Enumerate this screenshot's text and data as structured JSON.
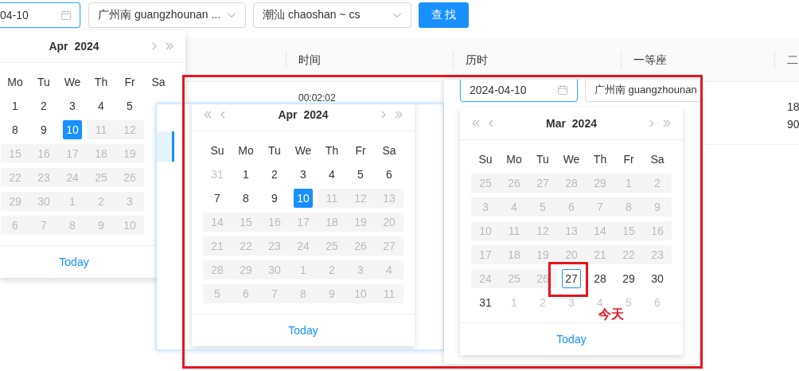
{
  "toolbar": {
    "date_field": {
      "value": "04-10"
    },
    "from_station": {
      "value": "广州南 guangzhounan ..."
    },
    "to_station": {
      "value": "潮汕 chaoshan ~ cs"
    },
    "search_button": {
      "label": "查 找"
    }
  },
  "table": {
    "columns": [
      {
        "label": "时间"
      },
      {
        "label": "历时"
      },
      {
        "label": "一等座"
      },
      {
        "label": "二"
      }
    ],
    "row": {
      "time": "00:02:02",
      "column_4": [
        "18",
        "90"
      ]
    }
  },
  "dropdown_calendar": {
    "title": "Apr 2024",
    "nav_buttons": [
      {
        "kind": "next-month"
      },
      {
        "kind": "next-year"
      }
    ],
    "weekdays": [
      "Mo",
      "Tu",
      "We",
      "Th",
      "Fr",
      "Sa"
    ],
    "weeks": [
      [
        {
          "day": "1",
          "kind": "current",
          "selected": false
        },
        {
          "day": "2",
          "kind": "current",
          "selected": false
        },
        {
          "day": "3",
          "kind": "current",
          "selected": false
        },
        {
          "day": "4",
          "kind": "current",
          "selected": false
        },
        {
          "day": "5",
          "kind": "current",
          "selected": false
        }
      ],
      [
        {
          "day": "8",
          "kind": "current",
          "selected": false
        },
        {
          "day": "9",
          "kind": "current",
          "selected": false
        },
        {
          "day": "10",
          "kind": "current",
          "selected": true
        },
        {
          "day": "11",
          "kind": "disabled",
          "selected": false
        },
        {
          "day": "12",
          "kind": "disabled",
          "selected": false
        }
      ],
      [
        {
          "day": "15",
          "kind": "disabled",
          "selected": false
        },
        {
          "day": "16",
          "kind": "disabled",
          "selected": false
        },
        {
          "day": "17",
          "kind": "disabled",
          "selected": false
        },
        {
          "day": "18",
          "kind": "disabled",
          "selected": false
        },
        {
          "day": "19",
          "kind": "disabled",
          "selected": false
        }
      ],
      [
        {
          "day": "22",
          "kind": "disabled",
          "selected": false
        },
        {
          "day": "23",
          "kind": "disabled",
          "selected": false
        },
        {
          "day": "24",
          "kind": "disabled",
          "selected": false
        },
        {
          "day": "25",
          "kind": "disabled",
          "selected": false
        },
        {
          "day": "26",
          "kind": "disabled",
          "selected": false
        }
      ],
      [
        {
          "day": "29",
          "kind": "disabled",
          "selected": false
        },
        {
          "day": "30",
          "kind": "disabled",
          "selected": false
        },
        {
          "day": "1",
          "kind": "disabled",
          "selected": false
        },
        {
          "day": "2",
          "kind": "disabled",
          "selected": false
        },
        {
          "day": "3",
          "kind": "disabled",
          "selected": false
        }
      ],
      [
        {
          "day": "6",
          "kind": "disabled",
          "selected": false
        },
        {
          "day": "7",
          "kind": "disabled",
          "selected": false
        },
        {
          "day": "8",
          "kind": "disabled",
          "selected": false
        },
        {
          "day": "9",
          "kind": "disabled",
          "selected": false
        },
        {
          "day": "10",
          "kind": "disabled",
          "selected": false
        }
      ]
    ],
    "footer": "Today"
  },
  "screenshot_1": {
    "calendar": {
      "title": "Apr 2024",
      "nav_buttons": [
        {
          "kind": "prev-year"
        },
        {
          "kind": "prev-month"
        },
        {
          "kind": "next-month"
        },
        {
          "kind": "next-year"
        }
      ],
      "weekdays": [
        "Su",
        "Mo",
        "Tu",
        "We",
        "Th",
        "Fr",
        "Sa"
      ],
      "weeks": [
        [
          {
            "day": "31",
            "kind": "adjacent",
            "selected": false
          },
          {
            "day": "1",
            "kind": "current",
            "selected": false
          },
          {
            "day": "2",
            "kind": "current",
            "selected": false
          },
          {
            "day": "3",
            "kind": "current",
            "selected": false
          },
          {
            "day": "4",
            "kind": "current",
            "selected": false
          },
          {
            "day": "5",
            "kind": "current",
            "selected": false
          },
          {
            "day": "6",
            "kind": "current",
            "selected": false
          }
        ],
        [
          {
            "day": "7",
            "kind": "current",
            "selected": false
          },
          {
            "day": "8",
            "kind": "current",
            "selected": false
          },
          {
            "day": "9",
            "kind": "current",
            "selected": false
          },
          {
            "day": "10",
            "kind": "current",
            "selected": true
          },
          {
            "day": "11",
            "kind": "disabled",
            "selected": false
          },
          {
            "day": "12",
            "kind": "disabled",
            "selected": false
          },
          {
            "day": "13",
            "kind": "disabled",
            "selected": false
          }
        ],
        [
          {
            "day": "14",
            "kind": "disabled",
            "selected": false
          },
          {
            "day": "15",
            "kind": "disabled",
            "selected": false
          },
          {
            "day": "16",
            "kind": "disabled",
            "selected": false
          },
          {
            "day": "17",
            "kind": "disabled",
            "selected": false
          },
          {
            "day": "18",
            "kind": "disabled",
            "selected": false
          },
          {
            "day": "19",
            "kind": "disabled",
            "selected": false
          },
          {
            "day": "20",
            "kind": "disabled",
            "selected": false
          }
        ],
        [
          {
            "day": "21",
            "kind": "disabled",
            "selected": false
          },
          {
            "day": "22",
            "kind": "disabled",
            "selected": false
          },
          {
            "day": "23",
            "kind": "disabled",
            "selected": false
          },
          {
            "day": "24",
            "kind": "disabled",
            "selected": false
          },
          {
            "day": "25",
            "kind": "disabled",
            "selected": false
          },
          {
            "day": "26",
            "kind": "disabled",
            "selected": false
          },
          {
            "day": "27",
            "kind": "disabled",
            "selected": false
          }
        ],
        [
          {
            "day": "28",
            "kind": "disabled",
            "selected": false
          },
          {
            "day": "29",
            "kind": "disabled",
            "selected": false
          },
          {
            "day": "30",
            "kind": "disabled",
            "selected": false
          },
          {
            "day": "1",
            "kind": "disabled",
            "selected": false
          },
          {
            "day": "2",
            "kind": "disabled",
            "selected": false
          },
          {
            "day": "3",
            "kind": "disabled",
            "selected": false
          },
          {
            "day": "4",
            "kind": "disabled",
            "selected": false
          }
        ],
        [
          {
            "day": "5",
            "kind": "disabled",
            "selected": false
          },
          {
            "day": "6",
            "kind": "disabled",
            "selected": false
          },
          {
            "day": "7",
            "kind": "disabled",
            "selected": false
          },
          {
            "day": "8",
            "kind": "disabled",
            "selected": false
          },
          {
            "day": "9",
            "kind": "disabled",
            "selected": false
          },
          {
            "day": "10",
            "kind": "disabled",
            "selected": false
          },
          {
            "day": "11",
            "kind": "disabled",
            "selected": false
          }
        ]
      ],
      "footer": "Today"
    }
  },
  "screenshot_2": {
    "date_field": {
      "value": "2024-04-10"
    },
    "station_field": {
      "value": "广州南 guangzhounan"
    },
    "calendar": {
      "title": "Mar 2024",
      "nav_buttons": [
        {
          "kind": "prev-year"
        },
        {
          "kind": "prev-month"
        },
        {
          "kind": "next-month"
        },
        {
          "kind": "next-year"
        }
      ],
      "weekdays": [
        "Su",
        "Mo",
        "Tu",
        "We",
        "Th",
        "Fr",
        "Sa"
      ],
      "weeks": [
        [
          {
            "day": "25",
            "kind": "disabled",
            "selected": false
          },
          {
            "day": "26",
            "kind": "disabled",
            "selected": false
          },
          {
            "day": "27",
            "kind": "disabled",
            "selected": false
          },
          {
            "day": "28",
            "kind": "disabled",
            "selected": false
          },
          {
            "day": "29",
            "kind": "disabled",
            "selected": false
          },
          {
            "day": "1",
            "kind": "disabled",
            "selected": false
          },
          {
            "day": "2",
            "kind": "disabled",
            "selected": false
          }
        ],
        [
          {
            "day": "3",
            "kind": "disabled",
            "selected": false
          },
          {
            "day": "4",
            "kind": "disabled",
            "selected": false
          },
          {
            "day": "5",
            "kind": "disabled",
            "selected": false
          },
          {
            "day": "6",
            "kind": "disabled",
            "selected": false
          },
          {
            "day": "7",
            "kind": "disabled",
            "selected": false
          },
          {
            "day": "8",
            "kind": "disabled",
            "selected": false
          },
          {
            "day": "9",
            "kind": "disabled",
            "selected": false
          }
        ],
        [
          {
            "day": "10",
            "kind": "disabled",
            "selected": false
          },
          {
            "day": "11",
            "kind": "disabled",
            "selected": false
          },
          {
            "day": "12",
            "kind": "disabled",
            "selected": false
          },
          {
            "day": "13",
            "kind": "disabled",
            "selected": false
          },
          {
            "day": "14",
            "kind": "disabled",
            "selected": false
          },
          {
            "day": "15",
            "kind": "disabled",
            "selected": false
          },
          {
            "day": "16",
            "kind": "disabled",
            "selected": false
          }
        ],
        [
          {
            "day": "17",
            "kind": "disabled",
            "selected": false
          },
          {
            "day": "18",
            "kind": "disabled",
            "selected": false
          },
          {
            "day": "19",
            "kind": "disabled",
            "selected": false
          },
          {
            "day": "20",
            "kind": "disabled",
            "selected": false
          },
          {
            "day": "21",
            "kind": "disabled",
            "selected": false
          },
          {
            "day": "22",
            "kind": "disabled",
            "selected": false
          },
          {
            "day": "23",
            "kind": "disabled",
            "selected": false
          }
        ],
        [
          {
            "day": "24",
            "kind": "disabled",
            "selected": false
          },
          {
            "day": "25",
            "kind": "disabled",
            "selected": false
          },
          {
            "day": "26",
            "kind": "disabled",
            "selected": false
          },
          {
            "day": "27",
            "kind": "today",
            "selected": false
          },
          {
            "day": "28",
            "kind": "current",
            "selected": false
          },
          {
            "day": "29",
            "kind": "current",
            "selected": false
          },
          {
            "day": "30",
            "kind": "current",
            "selected": false
          }
        ],
        [
          {
            "day": "31",
            "kind": "current",
            "selected": false
          },
          {
            "day": "1",
            "kind": "adjacent",
            "selected": false
          },
          {
            "day": "2",
            "kind": "adjacent",
            "selected": false
          },
          {
            "day": "3",
            "kind": "adjacent",
            "selected": false
          },
          {
            "day": "4",
            "kind": "adjacent",
            "selected": false
          },
          {
            "day": "5",
            "kind": "adjacent",
            "selected": false
          },
          {
            "day": "6",
            "kind": "adjacent",
            "selected": false
          }
        ]
      ],
      "footer": "Today"
    },
    "annotation": {
      "label": "今天"
    }
  }
}
